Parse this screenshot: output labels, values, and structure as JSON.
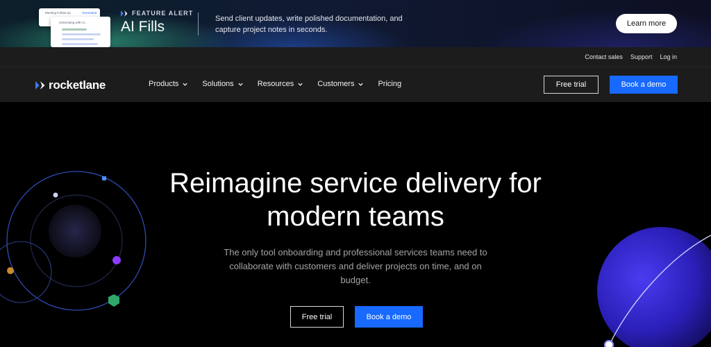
{
  "banner": {
    "card_back_title": "Meeting Follow-up",
    "card_back_pill": "Generated",
    "card_front_text": "Generating with AI...",
    "eyebrow": "FEATURE ALERT",
    "title": "AI Fills",
    "description": "Send client updates, write polished documentation, and capture project notes in seconds.",
    "cta_label": "Learn more"
  },
  "utility_nav": {
    "links": [
      "Contact sales",
      "Support",
      "Log in"
    ]
  },
  "nav": {
    "logo_text": "rocketlane",
    "menu": [
      {
        "label": "Products",
        "has_dropdown": true
      },
      {
        "label": "Solutions",
        "has_dropdown": true
      },
      {
        "label": "Resources",
        "has_dropdown": true
      },
      {
        "label": "Customers",
        "has_dropdown": true
      },
      {
        "label": "Pricing",
        "has_dropdown": false
      }
    ],
    "free_trial_label": "Free trial",
    "book_demo_label": "Book a demo"
  },
  "hero": {
    "title_line1": "Reimagine service delivery for",
    "title_line2": "modern teams",
    "subtitle": "The only tool onboarding and professional services teams need to collaborate with customers and deliver projects on time, and on budget.",
    "free_trial_label": "Free trial",
    "book_demo_label": "Book a demo"
  },
  "colors": {
    "primary_blue": "#1769ff",
    "nav_background": "#1c1c1c",
    "hero_background": "#000000",
    "banner_background": "#101a33"
  },
  "icons": {
    "feature_alert": "rocketlane-chevron-icon",
    "logo_mark": "rocketlane-chevron-icon",
    "dropdown": "chevron-down-icon"
  }
}
